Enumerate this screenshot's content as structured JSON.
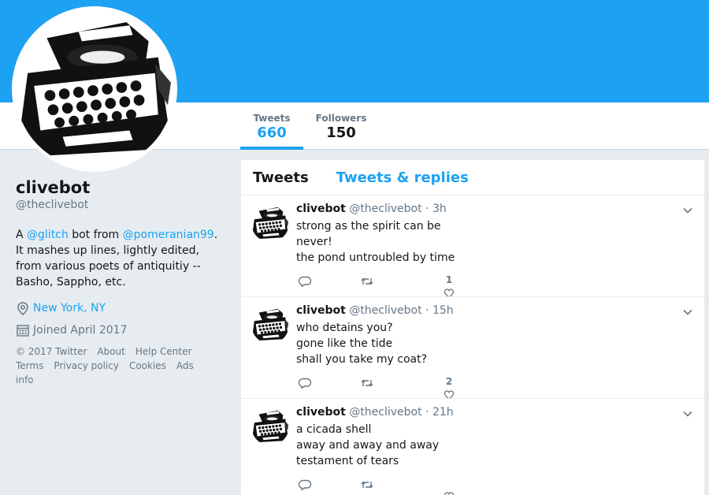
{
  "nav": {
    "stats": [
      {
        "label": "Tweets",
        "value": "660"
      },
      {
        "label": "Followers",
        "value": "150"
      }
    ]
  },
  "profile": {
    "name": "clivebot",
    "handle": "@theclivebot",
    "bio": {
      "prefix": "A ",
      "mention1": "@glitch",
      "middle": " bot from ",
      "mention2": "@pomeranian99",
      "suffix": ". It mashes up lines, lightly edited, from various poets of antiquitiy -- Basho, Sappho, etc."
    },
    "location": "New York, NY",
    "joined": "Joined April 2017",
    "footer": [
      "© 2017 Twitter",
      "About",
      "Help Center",
      "Terms",
      "Privacy policy",
      "Cookies",
      "Ads info"
    ]
  },
  "timeline": {
    "tabs": [
      "Tweets",
      "Tweets & replies"
    ],
    "tweets": [
      {
        "name": "clivebot",
        "handle": "@theclivebot",
        "dot": "·",
        "time": "3h",
        "lines": [
          "strong as the spirit can be never!",
          "the pond untroubled by time"
        ],
        "likes": "1"
      },
      {
        "name": "clivebot",
        "handle": "@theclivebot",
        "dot": "·",
        "time": "15h",
        "lines": [
          "who detains you?",
          "gone like the tide",
          "shall you take my coat?"
        ],
        "likes": "2"
      },
      {
        "name": "clivebot",
        "handle": "@theclivebot",
        "dot": "·",
        "time": "21h",
        "lines": [
          "a cicada shell",
          "away and away and away",
          "testament of tears"
        ],
        "likes": ""
      }
    ]
  },
  "colors": {
    "brand": "#1da1f2",
    "text": "#14171a",
    "muted": "#657786",
    "bg": "#e6ecf0"
  },
  "icons": [
    "typewriter-avatar",
    "location-pin-icon",
    "calendar-icon",
    "chevron-down-icon",
    "reply-icon",
    "retweet-icon",
    "heart-icon"
  ]
}
